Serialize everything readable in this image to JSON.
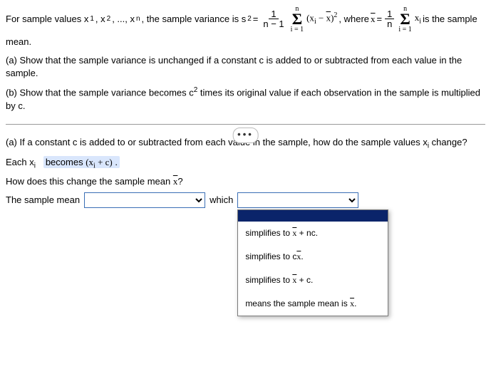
{
  "intro": {
    "t1": "For sample values x",
    "s1": "1",
    "t2": ", x",
    "s2": "2",
    "t3": ", ..., x",
    "sn": "n",
    "t4": ", the sample variance is s",
    "sq": "2",
    "eq": " = ",
    "frac1n": "1",
    "frac1d": "n − 1",
    "sumtop": "n",
    "sumbot": "i = 1",
    "body1a": "(x",
    "body1sub": "i",
    "body1b": " − ",
    "body1bar": "x",
    "body1c": ")",
    "body1sup": "2",
    "where": ", where ",
    "xbar": "x",
    "eq2": " = ",
    "frac2n": "1",
    "frac2d": "n",
    "body2a": " x",
    "body2sub": "i",
    "tail": " is the sample"
  },
  "intro2": "mean.",
  "partA": "(a) Show that the sample variance is unchanged if a constant c is added to or subtracted from each value in the sample.",
  "partB_1": "(b) Show that the sample variance becomes c",
  "partB_sup": "2",
  "partB_2": " times its original value if each observation in the sample is multiplied by c.",
  "dots": "•••",
  "qA": {
    "prompt_1": "(a) If a constant c is added to or subtracted from each value in the sample, how do the sample values x",
    "prompt_sub": "i",
    "prompt_2": " change?",
    "each1": "Each x",
    "eachsub": "i",
    "hlpre": "becomes ",
    "hlexp_a": "(x",
    "hlexp_sub": "i",
    "hlexp_b": " + c)",
    "hlexp_c": " .",
    "how1": "How does this change the sample mean ",
    "howbar": "x",
    "how2": "?",
    "line_a": "The sample mean",
    "which": "which"
  },
  "dd": {
    "opt1_a": "simplifies to ",
    "opt1_bar": "x",
    "opt1_b": " + nc.",
    "opt2_a": "simplifies to c",
    "opt2_bar": "x",
    "opt2_b": ".",
    "opt3_a": "simplifies to ",
    "opt3_bar": "x",
    "opt3_b": " + c.",
    "opt4_a": "means the sample mean is ",
    "opt4_bar": "x",
    "opt4_b": "."
  }
}
